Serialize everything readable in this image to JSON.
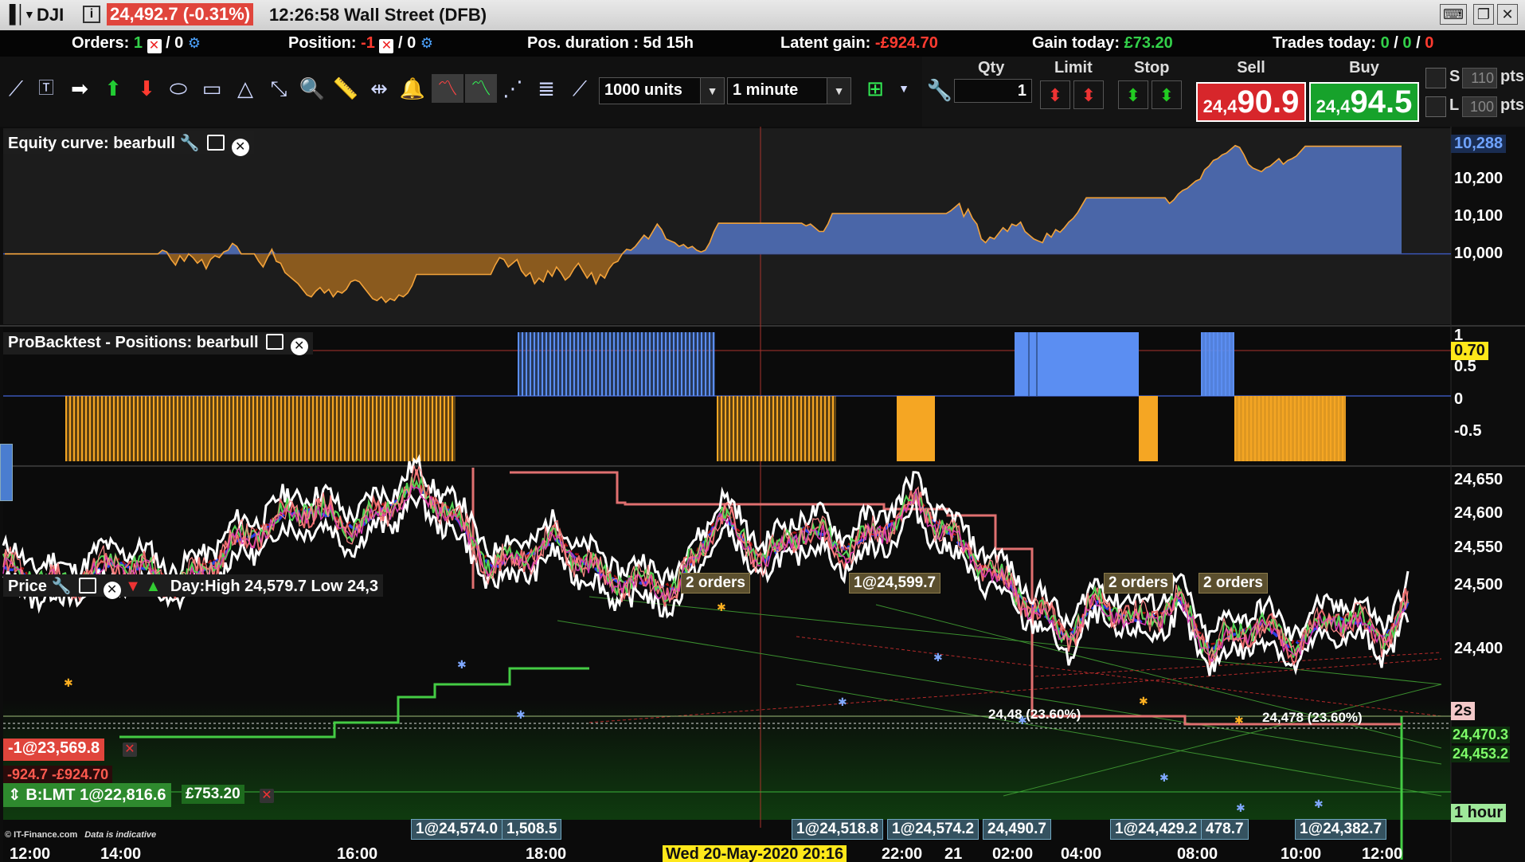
{
  "titlebar": {
    "symbol": "DJI",
    "price_change": "24,492.7 (-0.31%)",
    "time_market": "12:26:58 Wall Street (DFB)"
  },
  "infobar": {
    "orders_label": "Orders:",
    "orders_count": "1",
    "orders_zero": "/ 0",
    "position_label": "Position:",
    "position_value": "-1",
    "position_zero": "/ 0",
    "duration": "Pos. duration : 5d 15h",
    "latent_label": "Latent gain:",
    "latent_value": "-£924.70",
    "gain_label": "Gain today:",
    "gain_value": "£73.20",
    "trades_label": "Trades today:",
    "trades_a": "0",
    "trades_b": "0",
    "trades_c": "0"
  },
  "toolbar": {
    "units": "1000 units",
    "timeframe": "1 minute",
    "qty_label": "Qty",
    "qty_value": "1",
    "limit_label": "Limit",
    "stop_label": "Stop",
    "sell_label": "Sell",
    "sell_small": "24,4",
    "sell_big": "90.9",
    "buy_label": "Buy",
    "buy_small": "24,4",
    "buy_big": "94.5",
    "s_label": "S",
    "l_label": "L",
    "s_pts": "110",
    "l_pts": "100",
    "pts": "pts",
    "colors": {
      "sell": "#d7262b",
      "buy": "#17a22b"
    }
  },
  "equity": {
    "title": "Equity curve: bearbull",
    "axis": [
      "10,200",
      "10,100",
      "10,000"
    ],
    "current": "10,288",
    "baseline": 10000,
    "values": [
      10000,
      10000,
      10000,
      10000,
      10000,
      10000,
      10000,
      10000,
      10000,
      10000,
      10000,
      10000,
      10000,
      10000,
      10000,
      10000,
      10000,
      10000,
      10000,
      10000,
      10000,
      10000,
      10000,
      10000,
      10000,
      10000,
      10000,
      10000,
      10000,
      10000,
      10000,
      10000,
      10000,
      10000,
      10000,
      10000,
      10010,
      10005,
      9985,
      9970,
      9995,
      9980,
      10000,
      9990,
      9975,
      9985,
      9960,
      9985,
      9995,
      9990,
      10005,
      10010,
      10028,
      10020,
      10000,
      10000,
      10000,
      10000,
      9980,
      9965,
      9990,
      10012,
      9980,
      9975,
      9950,
      9940,
      9930,
      9920,
      9905,
      9890,
      9885,
      9900,
      9910,
      9895,
      9905,
      9885,
      9900,
      9895,
      9905,
      9925,
      9930,
      9925,
      9910,
      9895,
      9880,
      9875,
      9885,
      9870,
      9880,
      9875,
      9890,
      9885,
      9895,
      9915,
      9945,
      9945,
      9945,
      9945,
      9945,
      9945,
      9945,
      9945,
      9945,
      9945,
      9945,
      9945,
      9945,
      9945,
      9945,
      9945,
      9945,
      9945,
      9970,
      9990,
      9985,
      9965,
      9975,
      9985,
      9955,
      9940,
      9950,
      9920,
      9935,
      9925,
      9955,
      9940,
      9965,
      9950,
      9930,
      9940,
      9960,
      9975,
      9955,
      9935,
      9950,
      9920,
      9945,
      9935,
      9960,
      9975,
      9980,
      10000,
      10012,
      10010,
      10020,
      10035,
      10050,
      10040,
      10060,
      10080,
      10065,
      10040,
      10035,
      10030,
      10020,
      10025,
      10015,
      10020,
      10010,
      10005,
      10010,
      10030,
      10060,
      10082,
      10082,
      10082,
      10082,
      10082,
      10082,
      10082,
      10082,
      10082,
      10082,
      10082,
      10082,
      10082,
      10082,
      10082,
      10082,
      10082,
      10082,
      10082,
      10082,
      10075,
      10080,
      10070,
      10060,
      10060,
      10080,
      10108,
      10108,
      10108,
      10108,
      10108,
      10108,
      10108,
      10108,
      10108,
      10108,
      10108,
      10108,
      10108,
      10108,
      10108,
      10108,
      10108,
      10108,
      10108,
      10108,
      10108,
      10108,
      10108,
      10108,
      10108,
      10108,
      10108,
      10115,
      10125,
      10135,
      10100,
      10120,
      10095,
      10080,
      10040,
      10030,
      10045,
      10040,
      10055,
      10070,
      10060,
      10080,
      10075,
      10085,
      10060,
      10050,
      10040,
      10035,
      10030,
      10055,
      10045,
      10065,
      10058,
      10070,
      10085,
      10095,
      10110,
      10130,
      10150,
      10150,
      10150,
      10150,
      10150,
      10150,
      10150,
      10150,
      10150,
      10150,
      10150,
      10150,
      10150,
      10150,
      10150,
      10150,
      10150,
      10150,
      10150,
      10135,
      10145,
      10160,
      10170,
      10175,
      10185,
      10195,
      10200,
      10225,
      10235,
      10250,
      10255,
      10265,
      10270,
      10280,
      10290,
      10285,
      10265,
      10240,
      10230,
      10225,
      10220,
      10230,
      10235,
      10245,
      10255,
      10240,
      10250,
      10255,
      10262,
      10275,
      10288,
      10288,
      10288,
      10288,
      10288,
      10288,
      10288,
      10288,
      10288,
      10288,
      10288,
      10288,
      10288,
      10288,
      10288,
      10288,
      10288,
      10288,
      10288,
      10288,
      10288,
      10288,
      10288
    ]
  },
  "positions": {
    "title": "ProBacktest - Positions: bearbull",
    "axis": [
      "1",
      "0.5",
      "0",
      "-0.5"
    ],
    "marker": "0.70",
    "marker_color": "#ffe81a",
    "long_color": "#5b8ef2",
    "short_color": "#f5a623"
  },
  "price": {
    "title": "Price",
    "daylabel": "Day:High 24,579.7 Low 24,3",
    "axis": [
      "24,650",
      "24,600",
      "24,550",
      "24,500",
      "24,400"
    ],
    "last_a": "24,470.3",
    "last_b": "24,453.2",
    "tf_badge": "2s",
    "tf_badge2": "1 hour",
    "order_tags": [
      "2 orders",
      "1@24,599.7",
      "2 orders",
      "2 orders"
    ],
    "fill_tags": [
      "1@24,574.0",
      "1,508.5",
      "1@24,518.8",
      "1@24,574.2",
      "24,490.7",
      "1@24,429.2",
      "478.7",
      "1@24,382.7"
    ],
    "fib1": "24,48  (23.60%)",
    "fib2": "24,478 (23.60%)",
    "pos_short": "-1@23,569.8",
    "pos_pl": "-924.7 -£924.70",
    "pos_limit": "B:LMT 1@22,816.6",
    "pos_limit_gain": "£753.20",
    "watermark": "© IT-Finance.com",
    "watermark_note": "Data is indicative"
  },
  "xaxis": {
    "labels": [
      "12:00",
      "14:00",
      "16:00",
      "18:00",
      "22:00",
      "21",
      "02:00",
      "04:00",
      "08:00",
      "10:00",
      "12:00"
    ],
    "cursor_date": "Wed 20-May-2020 20:16"
  }
}
